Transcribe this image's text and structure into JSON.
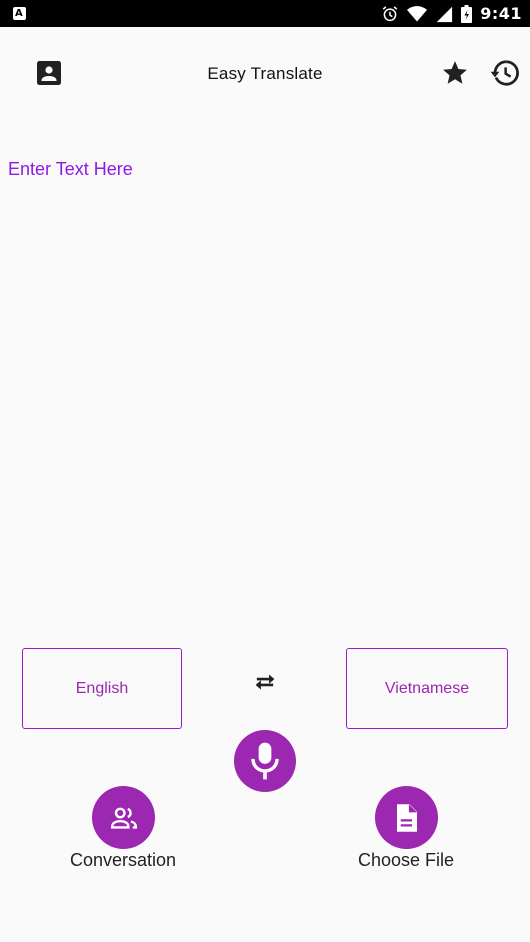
{
  "status_bar": {
    "notification_icon": "a-notification-icon",
    "notification_glyph": "A",
    "icons": [
      "alarm-icon",
      "wifi-icon",
      "signal-icon",
      "battery-icon"
    ],
    "time": "9:41"
  },
  "app_bar": {
    "title": "Easy Translate",
    "left_icon": "contact-icon",
    "right_icons": [
      "star-icon",
      "history-icon"
    ]
  },
  "input": {
    "placeholder": "Enter Text Here",
    "value": ""
  },
  "languages": {
    "source": "English",
    "target": "Vietnamese",
    "swap_icon": "swap-icon"
  },
  "actions": {
    "mic_icon": "microphone-icon",
    "conversation_label": "Conversation",
    "conversation_icon": "people-icon",
    "file_label": "Choose File",
    "file_icon": "file-icon"
  },
  "colors": {
    "accent": "#9c27b0",
    "placeholder": "#8f18e6",
    "background": "#fafafa",
    "status_bar": "#000000"
  }
}
